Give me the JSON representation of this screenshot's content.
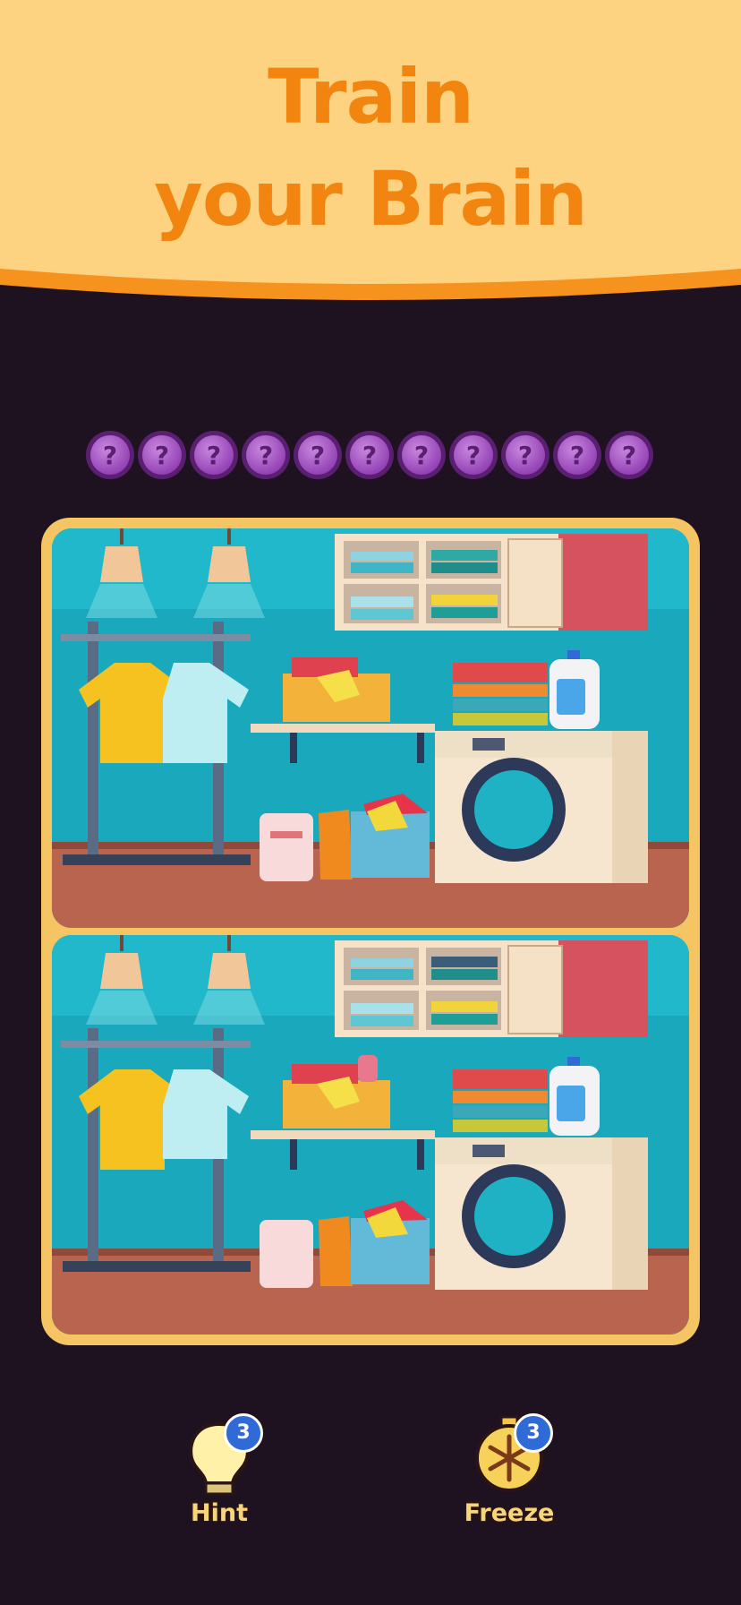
{
  "header": {
    "title_line1": "Train",
    "title_line2": "your Brain"
  },
  "progress": {
    "total_differences": 11,
    "found": 0,
    "token_symbol": "?"
  },
  "colors": {
    "banner": "#fdd382",
    "banner_edge": "#f6921e",
    "title": "#f2850f",
    "background": "#1f1220",
    "board_frame": "#f5c463",
    "token": "#a24fc1"
  },
  "powerups": {
    "hint": {
      "label": "Hint",
      "count": "3",
      "icon": "lightbulb-icon"
    },
    "freeze": {
      "label": "Freeze",
      "count": "3",
      "icon": "snowflake-stopwatch-icon"
    }
  }
}
